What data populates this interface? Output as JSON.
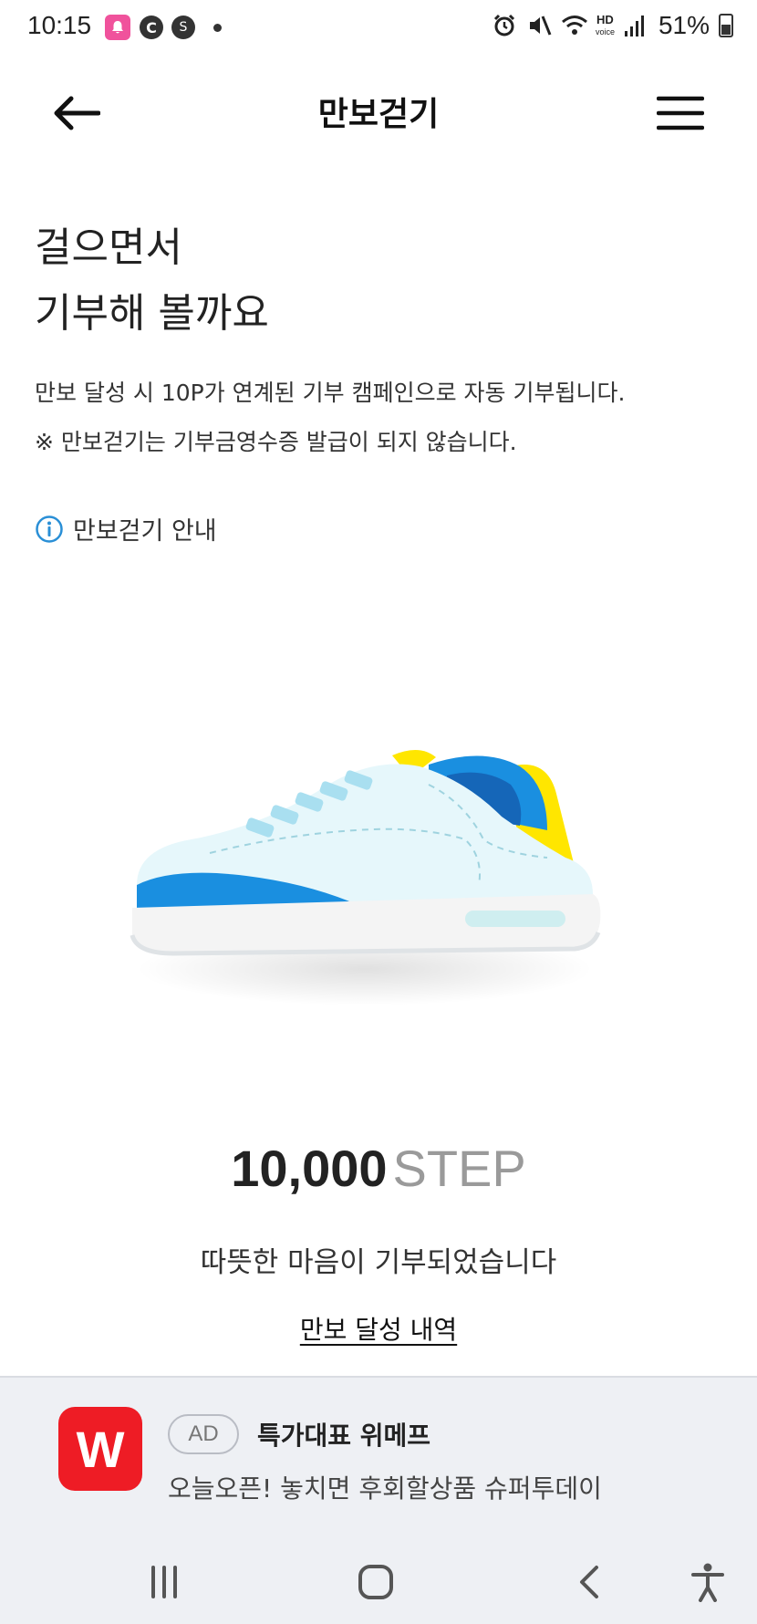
{
  "status_bar": {
    "time": "10:15",
    "battery": "51%",
    "icons": [
      "bell-notification-icon",
      "c-app-icon",
      "s-app-icon",
      "dot-icon",
      "alarm-icon",
      "mute-icon",
      "wifi-icon",
      "hd-voice-icon",
      "signal-icon",
      "battery-icon"
    ],
    "hd_label": "HD",
    "voice_label": "voice"
  },
  "header": {
    "title": "만보걷기",
    "back_icon": "arrow-left-icon",
    "menu_icon": "hamburger-menu-icon"
  },
  "intro": {
    "headline_line1": "걸으면서",
    "headline_line2": "기부해 볼까요",
    "desc_line1": "만보 달성 시 10P가 연계된 기부 캠페인으로 자동 기부됩니다.",
    "desc_line2": "※ 만보걷기는 기부금영수증 발급이 되지 않습니다.",
    "guide_label": "만보걷기 안내"
  },
  "progress": {
    "steps": "10,000",
    "unit": "STEP",
    "message": "따뜻한 마음이 기부되었습니다",
    "history_link": "만보 달성 내역"
  },
  "ad": {
    "logo_letter": "W",
    "badge": "AD",
    "title": "특가대표 위메프",
    "subtitle": "오늘오픈! 놓치면 후회할상품 슈퍼투데이"
  },
  "colors": {
    "accent_blue": "#1a8fe0",
    "ad_red": "#ee1c25",
    "shoe_yellow": "#ffe600",
    "info_blue": "#2a8fd6"
  }
}
